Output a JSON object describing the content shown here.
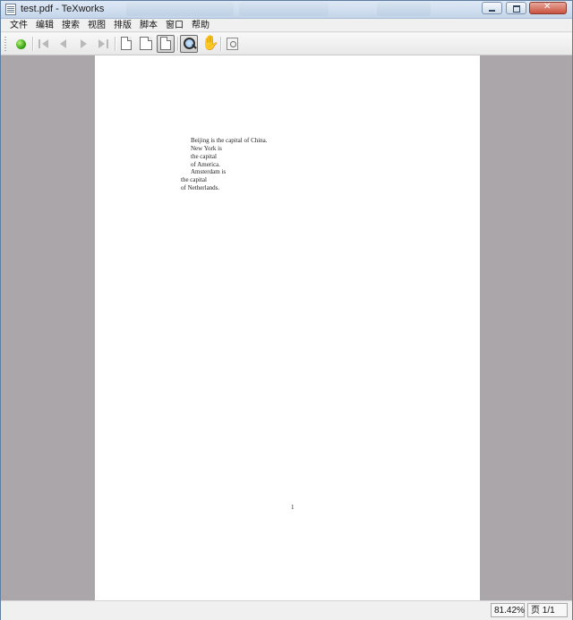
{
  "window": {
    "title": "test.pdf - TeXworks"
  },
  "menu": {
    "items": [
      "文件",
      "编辑",
      "搜索",
      "视图",
      "排版",
      "脚本",
      "窗口",
      "帮助"
    ]
  },
  "toolbar": {
    "icons": [
      "typeset-run-icon",
      "first-page-icon",
      "previous-page-icon",
      "next-page-icon",
      "last-page-icon",
      "actual-size-icon",
      "fit-width-icon",
      "fit-page-icon",
      "magnify-icon",
      "hand-scroll-icon",
      "find-icon"
    ]
  },
  "document": {
    "lines": [
      "Beijing is the capital of China.",
      "New York is",
      "the capital",
      "of America.",
      "Amsterdam is",
      "the capital",
      "of Netherlands."
    ],
    "page_number": "1"
  },
  "status": {
    "zoom": "81.42%",
    "page": "页 1/1"
  },
  "colors": {
    "titlebar": "#c4d5ea",
    "doc_background": "#aaa6aa",
    "page": "#ffffff",
    "run_button": "#3aa515"
  }
}
